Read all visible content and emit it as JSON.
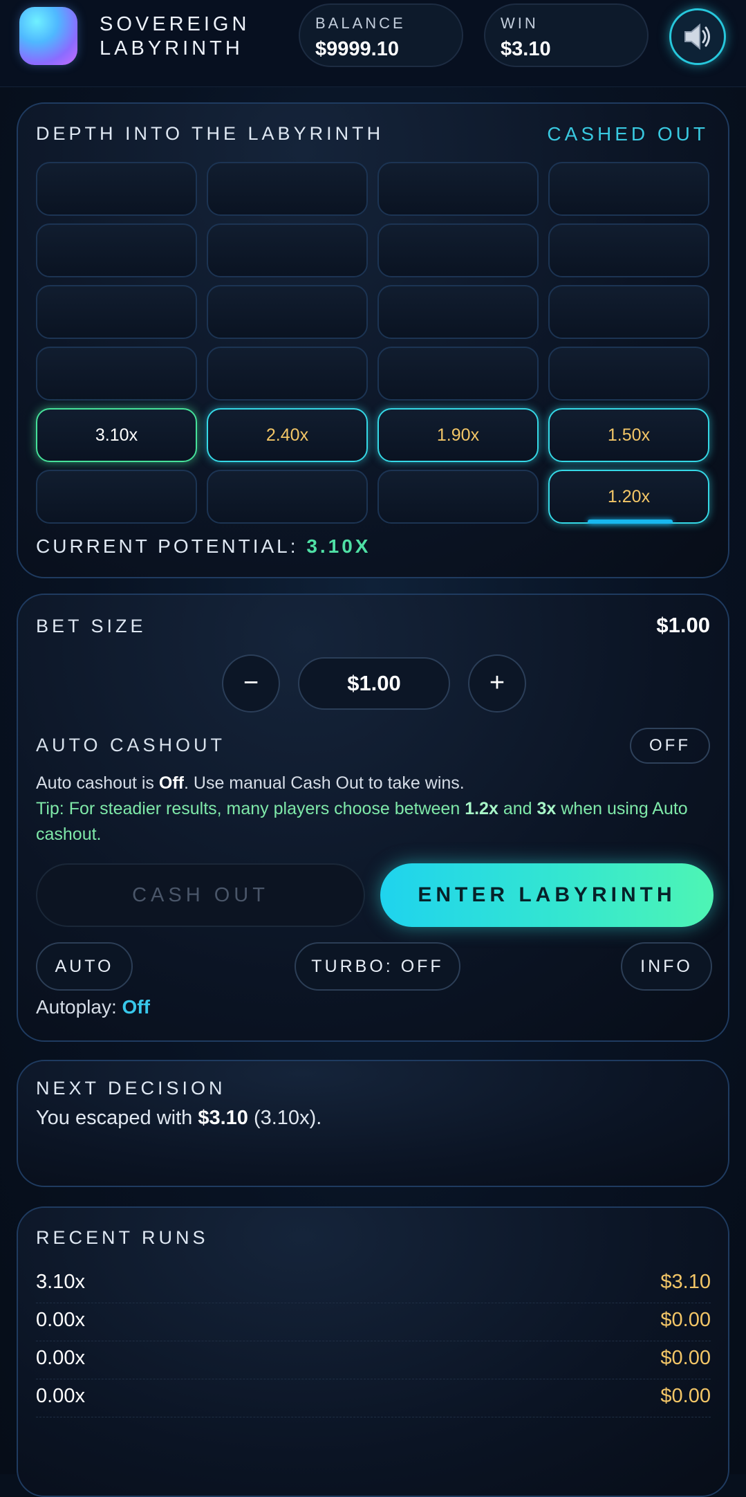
{
  "header": {
    "brand_line1": "SOVEREIGN",
    "brand_line2": "LABYRINTH",
    "balance_label": "BALANCE",
    "balance_value": "$9999.10",
    "win_label": "WIN",
    "win_value": "$3.10",
    "sound_icon": "speaker-icon"
  },
  "labyrinth": {
    "title": "DEPTH INTO THE LABYRINTH",
    "status": "CASHED OUT",
    "rows": [
      [
        "",
        "",
        "",
        ""
      ],
      [
        "",
        "",
        "",
        ""
      ],
      [
        "",
        "",
        "",
        ""
      ],
      [
        "",
        "",
        "",
        ""
      ],
      [
        "3.10x",
        "2.40x",
        "1.90x",
        "1.50x"
      ],
      [
        "",
        "",
        "",
        "1.20x"
      ]
    ],
    "potential_label": "CURRENT POTENTIAL:",
    "potential_value": "3.10X"
  },
  "bet": {
    "title": "BET SIZE",
    "value": "$1.00",
    "minus": "−",
    "amount": "$1.00",
    "plus": "+",
    "auto_cashout_label": "AUTO CASHOUT",
    "auto_cashout_toggle": "OFF",
    "desc_1": "Auto cashout is ",
    "desc_off": "Off",
    "desc_2": ". Use manual Cash Out to take wins.",
    "tip_1": "Tip: For steadier results, many players choose between ",
    "tip_low": "1.2x",
    "tip_and": " and ",
    "tip_high": "3x",
    "tip_2": " when using Auto cashout.",
    "cash_out": "CASH OUT",
    "enter": "ENTER LABYRINTH",
    "auto": "AUTO",
    "turbo": "TURBO: OFF",
    "info": "INFO",
    "autoplay_label": "Autoplay: ",
    "autoplay_value": "Off"
  },
  "next_decision": {
    "title": "NEXT DECISION",
    "text_1": "You escaped with ",
    "amount": "$3.10",
    "text_2": " (3.10x)."
  },
  "recent_runs": {
    "title": "RECENT RUNS",
    "runs": [
      {
        "mult": "3.10x",
        "amount": "$3.10"
      },
      {
        "mult": "0.00x",
        "amount": "$0.00"
      },
      {
        "mult": "0.00x",
        "amount": "$0.00"
      },
      {
        "mult": "0.00x",
        "amount": "$0.00"
      }
    ]
  },
  "colors": {
    "accent": "#39c9e0",
    "win_green": "#4fe0a5",
    "gold": "#f3c667"
  }
}
